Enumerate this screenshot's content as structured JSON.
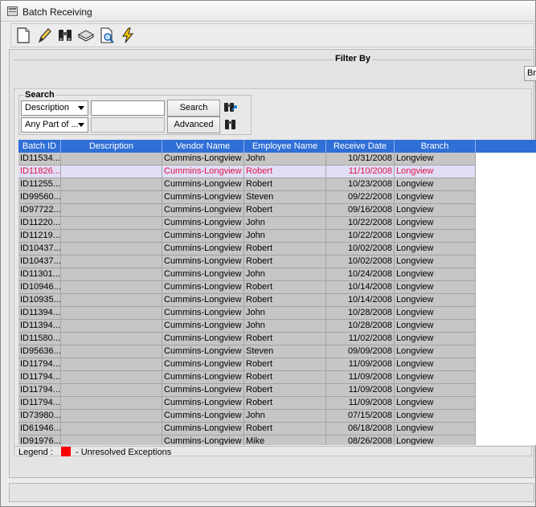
{
  "window": {
    "title": "Batch Receiving"
  },
  "toolbar": {
    "buttons": [
      {
        "name": "new-icon"
      },
      {
        "name": "edit-pencil-icon"
      },
      {
        "name": "binoculars-icon"
      },
      {
        "name": "receive-stack-icon"
      },
      {
        "name": "print-preview-icon"
      },
      {
        "name": "lightning-icon"
      }
    ]
  },
  "filter": {
    "label": "Filter By",
    "button_label": "Br"
  },
  "search": {
    "group_label": "Search",
    "field_select": "Description",
    "field_value": "",
    "match_select": "Any Part of ...",
    "search_button": "Search",
    "advanced_button": "Advanced"
  },
  "grid": {
    "columns": [
      "Batch ID",
      "Description",
      "Vendor Name",
      "Employee Name",
      "Receive Date",
      "Branch"
    ],
    "selected_row": 1,
    "rows": [
      [
        "ID11534...",
        "",
        "Cummins-Longview",
        "John",
        "10/31/2008",
        "Longview"
      ],
      [
        "ID11826...",
        "",
        "Cummins-Longview",
        "Robert",
        "11/10/2008",
        "Longview"
      ],
      [
        "ID11255...",
        "",
        "Cummins-Longview",
        "Robert",
        "10/23/2008",
        "Longview"
      ],
      [
        "ID99560...",
        "",
        "Cummins-Longview",
        "Steven",
        "09/22/2008",
        "Longview"
      ],
      [
        "ID97722...",
        "",
        "Cummins-Longview",
        "Robert",
        "09/16/2008",
        "Longview"
      ],
      [
        "ID11220...",
        "",
        "Cummins-Longview",
        "John",
        "10/22/2008",
        "Longview"
      ],
      [
        "ID11219...",
        "",
        "Cummins-Longview",
        "John",
        "10/22/2008",
        "Longview"
      ],
      [
        "ID10437...",
        "",
        "Cummins-Longview",
        "Robert",
        "10/02/2008",
        "Longview"
      ],
      [
        "ID10437...",
        "",
        "Cummins-Longview",
        "Robert",
        "10/02/2008",
        "Longview"
      ],
      [
        "ID11301...",
        "",
        "Cummins-Longview",
        "John",
        "10/24/2008",
        "Longview"
      ],
      [
        "ID10946...",
        "",
        "Cummins-Longview",
        "Robert",
        "10/14/2008",
        "Longview"
      ],
      [
        "ID10935...",
        "",
        "Cummins-Longview",
        "Robert",
        "10/14/2008",
        "Longview"
      ],
      [
        "ID11394...",
        "",
        "Cummins-Longview",
        "John",
        "10/28/2008",
        "Longview"
      ],
      [
        "ID11394...",
        "",
        "Cummins-Longview",
        "John",
        "10/28/2008",
        "Longview"
      ],
      [
        "ID11580...",
        "",
        "Cummins-Longview",
        "Robert",
        "11/02/2008",
        "Longview"
      ],
      [
        "ID95636...",
        "",
        "Cummins-Longview",
        "Steven",
        "09/09/2008",
        "Longview"
      ],
      [
        "ID11794...",
        "",
        "Cummins-Longview",
        "Robert",
        "11/09/2008",
        "Longview"
      ],
      [
        "ID11794...",
        "",
        "Cummins-Longview",
        "Robert",
        "11/09/2008",
        "Longview"
      ],
      [
        "ID11794...",
        "",
        "Cummins-Longview",
        "Robert",
        "11/09/2008",
        "Longview"
      ],
      [
        "ID11794...",
        "",
        "Cummins-Longview",
        "Robert",
        "11/09/2008",
        "Longview"
      ],
      [
        "ID73980...",
        "",
        "Cummins-Longview",
        "John",
        "07/15/2008",
        "Longview"
      ],
      [
        "ID61946...",
        "",
        "Cummins-Longview",
        "Robert",
        "06/18/2008",
        "Longview"
      ],
      [
        "ID91976...",
        "",
        "Cummins-Longview",
        "Mike",
        "08/26/2008",
        "Longview"
      ]
    ]
  },
  "legend": {
    "label": "Legend :",
    "items": [
      {
        "text": "- Unresolved Exceptions",
        "color": "#ff0000"
      }
    ]
  },
  "colors": {
    "header": "#2f6fd6",
    "row_bg": "#c6c6c6",
    "selected_bg": "#e2def5",
    "selected_text": "#e0154e"
  }
}
